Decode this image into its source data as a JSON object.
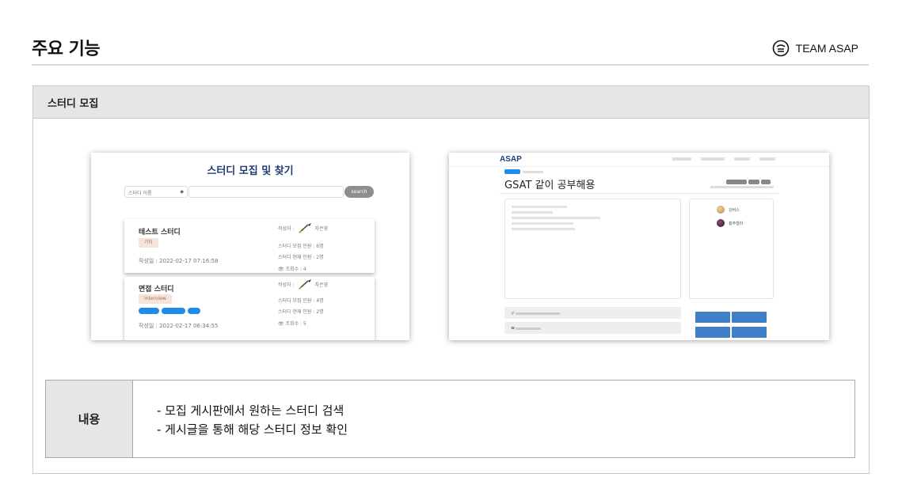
{
  "page": {
    "title": "주요 기능",
    "brand": "TEAM ASAP"
  },
  "panel": {
    "header": "스터디 모집",
    "content_label": "내용",
    "content_items": [
      "- 모집 게시판에서 원하는 스터디 검색",
      "- 게시글을 통해 해당 스터디 정보 확인"
    ]
  },
  "screenshot_list": {
    "title": "스터디 모집 및 찾기",
    "select_value": "스터디 이름",
    "search_button": "search",
    "cards": [
      {
        "name": "테스트 스터디",
        "tag": "기타",
        "date": "작성일 : 2022-02-17 07:16:58",
        "writer_label": "작성자 :",
        "writer": "차은영",
        "recruit": "스터디 모집 인원 : 6명",
        "current": "스터디 현재 인원 : 2명",
        "views": "조회수 : 4"
      },
      {
        "name": "면접 스터디",
        "tag": "interview",
        "chips": [
          "",
          "",
          ""
        ],
        "date": "작성일 : 2022-02-17 06:34:55",
        "writer_label": "작성자 :",
        "writer": "차은영",
        "recruit": "스터디 모집 인원 : 4명",
        "current": "스터디 현재 인원 : 2명",
        "views": "조회수 : 5"
      }
    ]
  },
  "screenshot_detail": {
    "logo": "ASAP",
    "nav": [
      "",
      "",
      "",
      ""
    ],
    "category": "",
    "category_sub": "",
    "title": "GSAT 같이 공부해용",
    "badges": [
      "",
      "",
      ""
    ],
    "meta": "",
    "body_lines": [
      "",
      "",
      "",
      "",
      ""
    ],
    "members": [
      "강버스",
      "흥주철라"
    ],
    "info_link": "",
    "info_phone": "",
    "buttons": [
      "",
      "",
      "",
      ""
    ]
  },
  "colors": {
    "list_title": "#233a73",
    "chip_blue": "#1e8ce8",
    "detail_button": "#3f7fc8",
    "header_gray": "#e6e6e6"
  }
}
